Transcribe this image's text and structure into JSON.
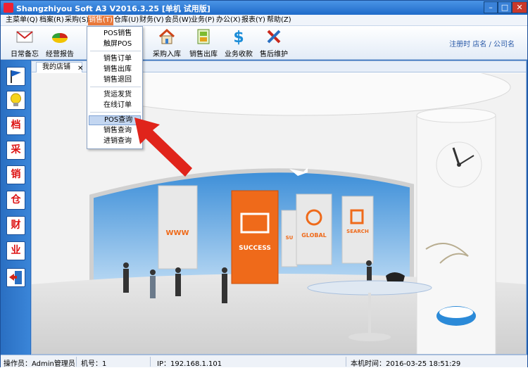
{
  "window": {
    "title": "Shangzhiyou Soft A3 V2016.3.25 [单机 试用版]"
  },
  "menu": [
    {
      "label": "主菜单(Q)"
    },
    {
      "label": "档案(R)"
    },
    {
      "label": "采购(S)"
    },
    {
      "label": "销售(T)"
    },
    {
      "label": "仓库(U)"
    },
    {
      "label": "财务(V)"
    },
    {
      "label": "会员(W)"
    },
    {
      "label": "业务(P)"
    },
    {
      "label": "办公(X)"
    },
    {
      "label": "报表(Y)"
    },
    {
      "label": "帮助(Z)"
    }
  ],
  "toolbar": {
    "items": [
      {
        "label": "日常备忘",
        "icon": "envelope-icon"
      },
      {
        "label": "经营报告",
        "icon": "pie-chart-icon"
      },
      {
        "label": "采购入库",
        "icon": "house-icon"
      },
      {
        "label": "销售出库",
        "icon": "goods-icon"
      },
      {
        "label": "业务收款",
        "icon": "dollar-icon"
      },
      {
        "label": "售后维护",
        "icon": "tools-icon"
      }
    ],
    "register_link": "注册时 店名 / 公司名"
  },
  "sidebar": {
    "items": [
      {
        "label": "",
        "icon": "flag-icon"
      },
      {
        "label": "",
        "icon": "bulb-icon"
      },
      {
        "label": "档"
      },
      {
        "label": "采"
      },
      {
        "label": "销"
      },
      {
        "label": "仓"
      },
      {
        "label": "财"
      },
      {
        "label": "业"
      },
      {
        "label": "",
        "icon": "exit-icon"
      }
    ]
  },
  "tabs": [
    {
      "label": "我的店铺"
    }
  ],
  "dropdown": {
    "items": [
      {
        "label": "POS销售"
      },
      {
        "label": "触屏POS"
      },
      {
        "label": "销售订单"
      },
      {
        "label": "销售出库"
      },
      {
        "label": "销售退回"
      },
      {
        "label": "货运发货"
      },
      {
        "label": "在线订单"
      },
      {
        "label": "POS查询"
      },
      {
        "label": "销售查询"
      },
      {
        "label": "进销查询"
      }
    ],
    "highlighted": "POS查询"
  },
  "scene": {
    "boards": [
      "WWW",
      "SUCCESS",
      "SU",
      "GLOBAL",
      "SEARCH"
    ]
  },
  "status": {
    "operator": "操作员：Admin管理员",
    "machine": "机号：1",
    "ip": "IP：192.168.1.101",
    "time": "本机时间：2016-03-25 18:51:29"
  },
  "colors": {
    "titlebar": "#1f6bc9",
    "menu_active": "#e8783a",
    "highlight": "#c3d6f1",
    "arrow": "#e0241b",
    "accent_orange": "#ef6a1a"
  }
}
